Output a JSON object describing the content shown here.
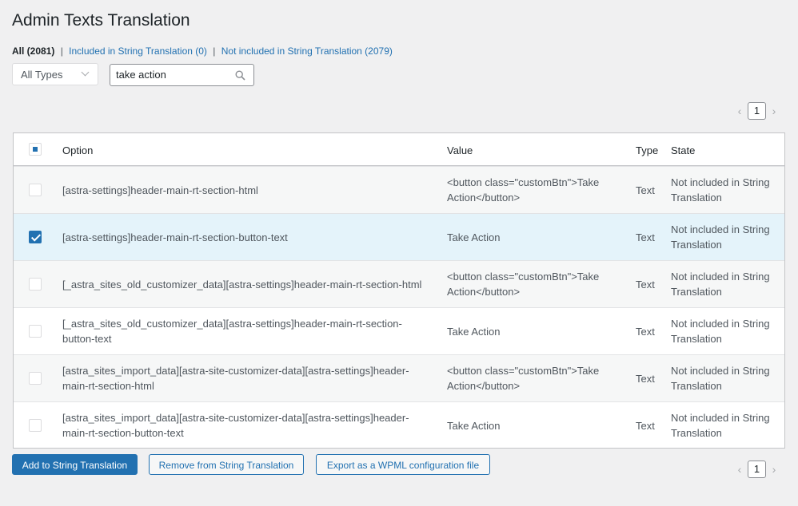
{
  "page": {
    "title": "Admin Texts Translation"
  },
  "filters": {
    "all": "All (2081)",
    "separator": "|",
    "included": "Included in String Translation (0)",
    "not_included": "Not included in String Translation (2079)"
  },
  "type_select": {
    "value": "All Types"
  },
  "search": {
    "value": "take action"
  },
  "pagination": {
    "prev": "‹",
    "page": "1",
    "next": "›"
  },
  "table": {
    "headers": {
      "option": "Option",
      "value": "Value",
      "type": "Type",
      "state": "State"
    },
    "rows": [
      {
        "option_lines": [
          "[astra-settings]header-main-rt-section-html"
        ],
        "value_lines": [
          "<button class=\"customBtn\">Take",
          "Action</button>"
        ],
        "type": "Text",
        "state_lines": [
          "Not included in String",
          "Translation"
        ],
        "checked": false
      },
      {
        "option_lines": [
          "[astra-settings]header-main-rt-section-button-text"
        ],
        "value_lines": [
          "Take Action"
        ],
        "type": "Text",
        "state_lines": [
          "Not included in String",
          "Translation"
        ],
        "checked": true
      },
      {
        "option_lines": [
          "[_astra_sites_old_customizer_data][astra-settings]header-main-rt-section-html"
        ],
        "value_lines": [
          "<button class=\"customBtn\">Take",
          "Action</button>"
        ],
        "type": "Text",
        "state_lines": [
          "Not included in String",
          "Translation"
        ],
        "checked": false
      },
      {
        "option_lines": [
          "[_astra_sites_old_customizer_data][astra-settings]header-main-rt-section-",
          "button-text"
        ],
        "value_lines": [
          "Take Action"
        ],
        "type": "Text",
        "state_lines": [
          "Not included in String",
          "Translation"
        ],
        "checked": false
      },
      {
        "option_lines": [
          "[astra_sites_import_data][astra-site-customizer-data][astra-settings]header-",
          "main-rt-section-html"
        ],
        "value_lines": [
          "<button class=\"customBtn\">Take",
          "Action</button>"
        ],
        "type": "Text",
        "state_lines": [
          "Not included in String",
          "Translation"
        ],
        "checked": false
      },
      {
        "option_lines": [
          "[astra_sites_import_data][astra-site-customizer-data][astra-settings]header-",
          "main-rt-section-button-text"
        ],
        "value_lines": [
          "Take Action"
        ],
        "type": "Text",
        "state_lines": [
          "Not included in String",
          "Translation"
        ],
        "checked": false
      }
    ]
  },
  "buttons": {
    "add": "Add to String Translation",
    "remove": "Remove from String Translation",
    "export": "Export as a WPML configuration file"
  },
  "colors": {
    "accent": "#2271b1",
    "selected_row": "#e4f3fa"
  },
  "icons": {
    "search": "search-icon",
    "dropdown": "chevron-down-icon"
  }
}
